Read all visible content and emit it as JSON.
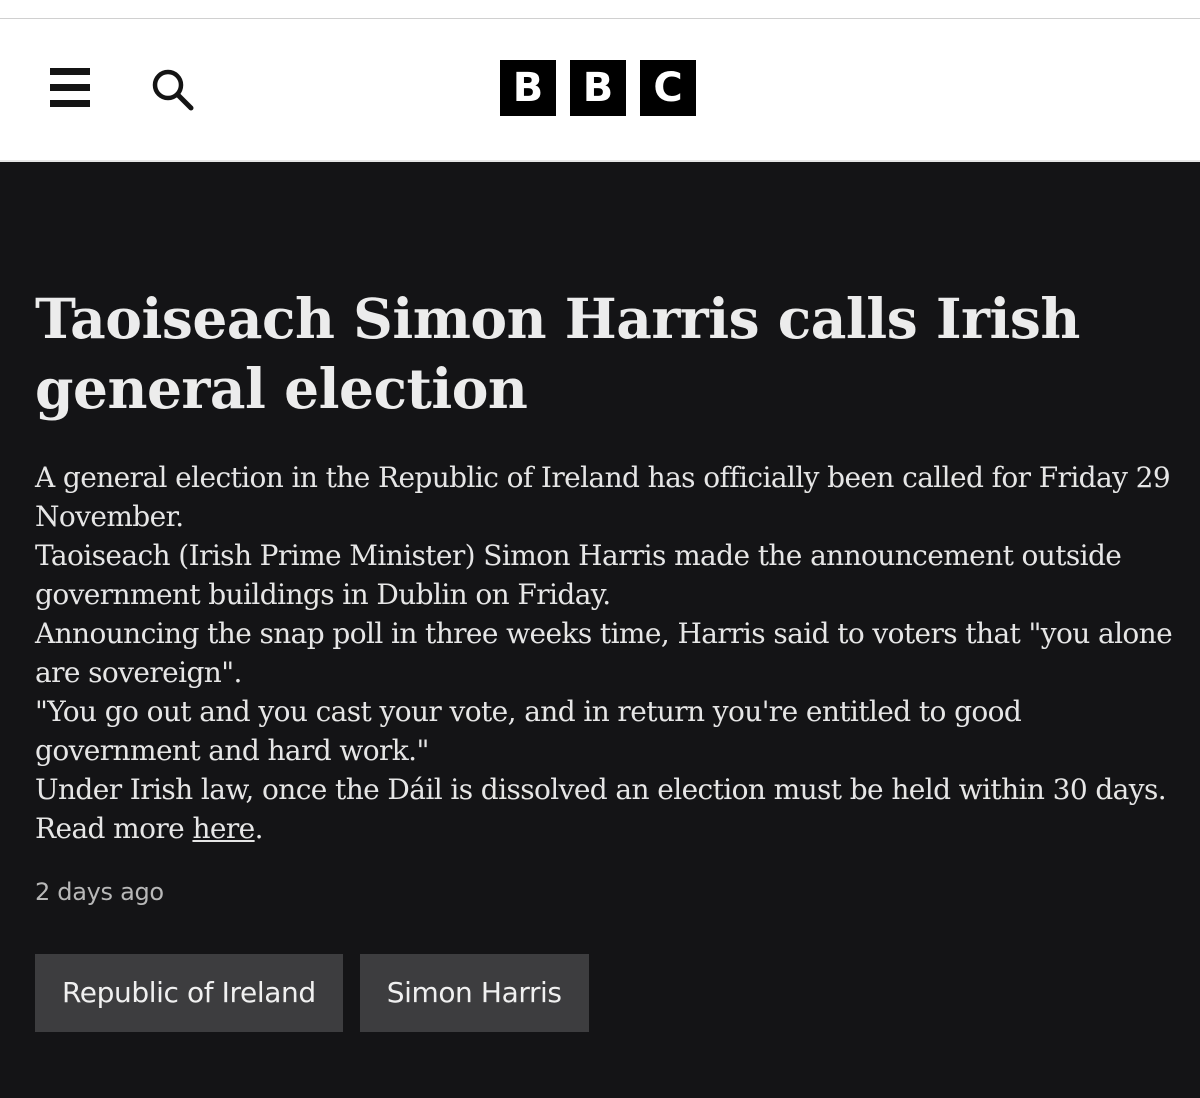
{
  "header": {
    "menu_icon": "menu-icon",
    "search_icon": "search-icon",
    "logo_letters": [
      "B",
      "B",
      "C"
    ]
  },
  "article": {
    "headline": "Taoiseach Simon Harris calls Irish general election",
    "paragraphs": [
      "A general election in the Republic of Ireland has officially been called for Friday 29 November.",
      "Taoiseach (Irish Prime Minister) Simon Harris made the announcement outside government buildings in Dublin on Friday.",
      "Announcing the snap poll in three weeks time, Harris said to voters that \"you alone are sovereign\".",
      "\"You go out and you cast your vote, and in return you're entitled to good government and hard work.\"",
      "Under Irish law, once the Dáil is dissolved an election must be held within 30 days."
    ],
    "read_more_prefix": "Read more ",
    "read_more_link": "here",
    "read_more_suffix": ".",
    "timestamp": "2 days ago",
    "tags": [
      "Republic of Ireland",
      "Simon Harris"
    ]
  },
  "colors": {
    "background": "#141416",
    "tag_background": "#3d3d3f",
    "text": "#e6e6e6",
    "logo_block": "#000000"
  }
}
